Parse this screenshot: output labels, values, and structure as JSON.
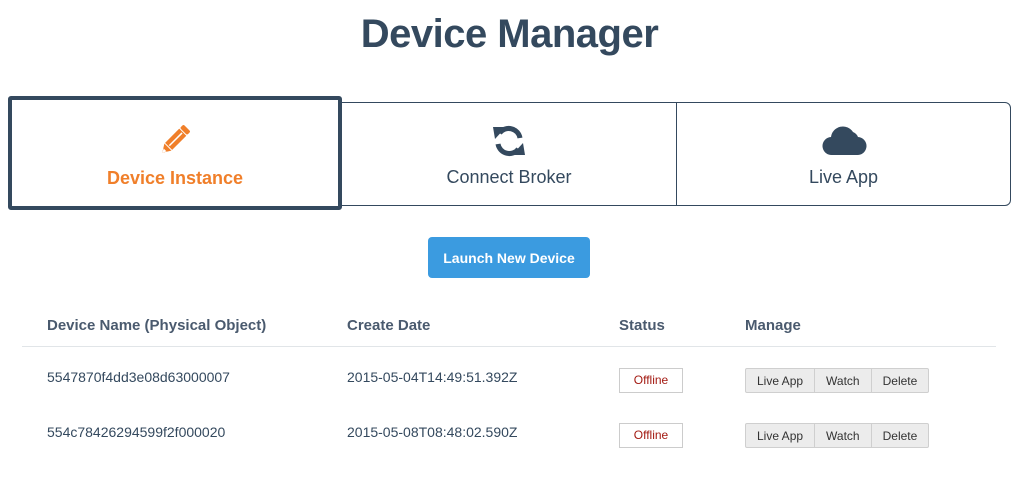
{
  "header": {
    "title": "Device Manager"
  },
  "tabs": [
    {
      "label": "Device Instance",
      "icon": "pencil-icon",
      "active": true
    },
    {
      "label": "Connect Broker",
      "icon": "refresh-icon",
      "active": false
    },
    {
      "label": "Live App",
      "icon": "cloud-icon",
      "active": false
    }
  ],
  "actions": {
    "launch_label": "Launch New Device"
  },
  "table": {
    "columns": [
      "Device Name (Physical Object)",
      "Create Date",
      "Status",
      "Manage"
    ],
    "rows": [
      {
        "name": "5547870f4dd3e08d63000007",
        "date": "2015-05-04T14:49:51.392Z",
        "status": "Offline"
      },
      {
        "name": "554c78426294599f2f000020",
        "date": "2015-05-08T08:48:02.590Z",
        "status": "Offline"
      }
    ],
    "manage_buttons": [
      "Live App",
      "Watch",
      "Delete"
    ]
  },
  "colors": {
    "primary": "#34495e",
    "accent": "#f07f2a",
    "button": "#3b9be0",
    "offline": "#a31a12"
  }
}
